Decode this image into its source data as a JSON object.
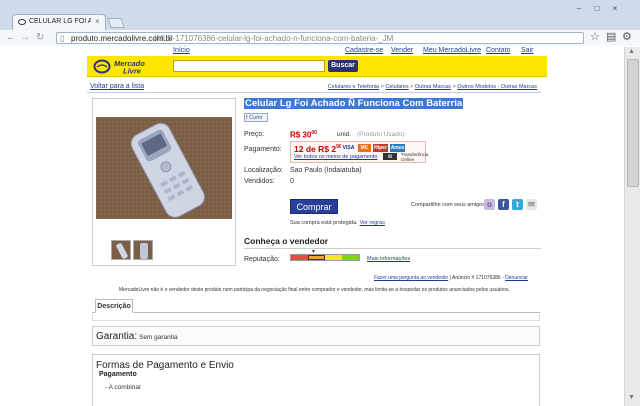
{
  "browser": {
    "tab_title": "CELULAR LG FOI ACHADO",
    "tab_close": "×",
    "url_domain": "produto.mercadolivre.com.br",
    "url_path": "/MLB-171076386-celular-lg-foi-achado-n-funciona-com-bateria-_JM",
    "window_controls": [
      "–",
      "□",
      "×"
    ]
  },
  "top_nav": {
    "home": "Início",
    "register": "Cadastre-se",
    "sell": "Vender",
    "my_ml": "Meu MercadoLivre",
    "contact": "Contato",
    "logout": "Sair"
  },
  "header": {
    "logo_line1": "Mercado",
    "logo_line2": "Livre",
    "search_value": "",
    "search_button": "Buscar"
  },
  "breadcrumb": {
    "back": "Voltar para a lista",
    "items": [
      "Celulares e Telefonia",
      "Celulares",
      "Outras Marcas",
      "Outros Modelos - Outras Marcas"
    ],
    "separator": ">"
  },
  "product": {
    "title": "Celular Lg Foi Achado Ñ Funciona Com Baterria",
    "like": "Curtir",
    "price_label": "Preço:",
    "price_main": "R$ 30",
    "price_cents": "00",
    "price_unit": "unid.",
    "price_condition": "(Produto Usado)",
    "payment_label": "Pagamento:",
    "installments_main": "12 de R$ 2",
    "installments_cents": "90",
    "payment_link": "Ver todos os meios de pagamento",
    "cards": [
      "VISA",
      "MC",
      "Amex",
      "Hiper"
    ],
    "transfer_label": "Transferência Online",
    "location_label": "Localização:",
    "location_value": "Sao Paulo (Indaiatuba)",
    "sold_label": "Vendidos:",
    "sold_value": "0",
    "buy_button": "Comprar",
    "protected_text": "Sua compra está protegida.",
    "protected_link": "Ver regras",
    "share_label": "Compartilhe com seus amigos:"
  },
  "seller": {
    "title": "Conheça o vendedor",
    "reputation_label": "Reputação:",
    "reputation_level": 0.33,
    "more_info": "Mais informações",
    "ask_link": "Fazer uma pergunta ao vendedor",
    "ad_number": "Anúncio # 171076386 -",
    "report_link": "Denunciar"
  },
  "disclaimer": "MercadoLivre não é o vendedor deste produto nem participa da negociação final entre comprador e vendedor, mas limita-se a hospedar os produtos anunciados pelos usuários.",
  "description_tab": "Descrição",
  "garantia": {
    "title": "Garantia:",
    "value": "Sem garantia"
  },
  "formas": {
    "title": "Formas de Pagamento e Envio",
    "subtitle": "Pagamento",
    "item": "- A combinar"
  },
  "colors": {
    "ml_yellow": "#ffe600",
    "ml_blue": "#2d3277",
    "price_red": "#cc0000",
    "link_blue": "#1f3b98"
  }
}
